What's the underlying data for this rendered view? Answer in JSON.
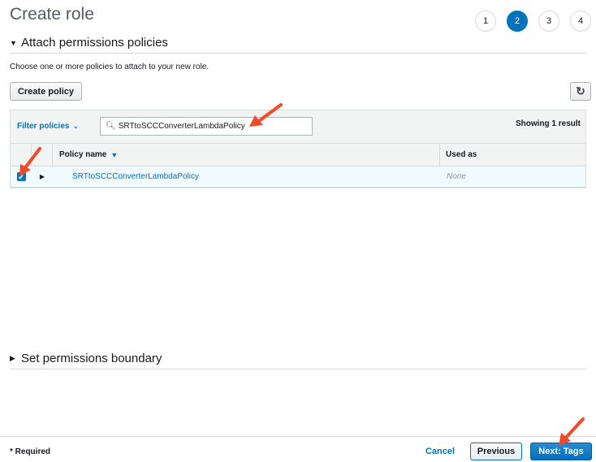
{
  "page": {
    "title": "Create role"
  },
  "steps": [
    "1",
    "2",
    "3",
    "4"
  ],
  "active_step": "2",
  "attach_section": {
    "title": "Attach permissions policies",
    "description": "Choose one or more policies to attach to your new role."
  },
  "toolbar": {
    "create_policy_label": "Create policy",
    "refresh_icon": "refresh-icon"
  },
  "filter": {
    "label": "Filter policies",
    "search_value": "SRTtoSCCConverterLambdaPolicy",
    "result_count": "Showing 1 result"
  },
  "table": {
    "columns": [
      "Policy name",
      "Used as"
    ],
    "rows": [
      {
        "checked": true,
        "policy_name": "SRTtoSCCConverterLambdaPolicy",
        "used_as": "None"
      }
    ]
  },
  "boundary_section": {
    "title": "Set permissions boundary"
  },
  "footer": {
    "required_note": "* Required",
    "cancel_label": "Cancel",
    "previous_label": "Previous",
    "next_label": "Next: Tags"
  },
  "colors": {
    "accent": "#0073bb",
    "annotation_arrow": "#f04a2a"
  }
}
